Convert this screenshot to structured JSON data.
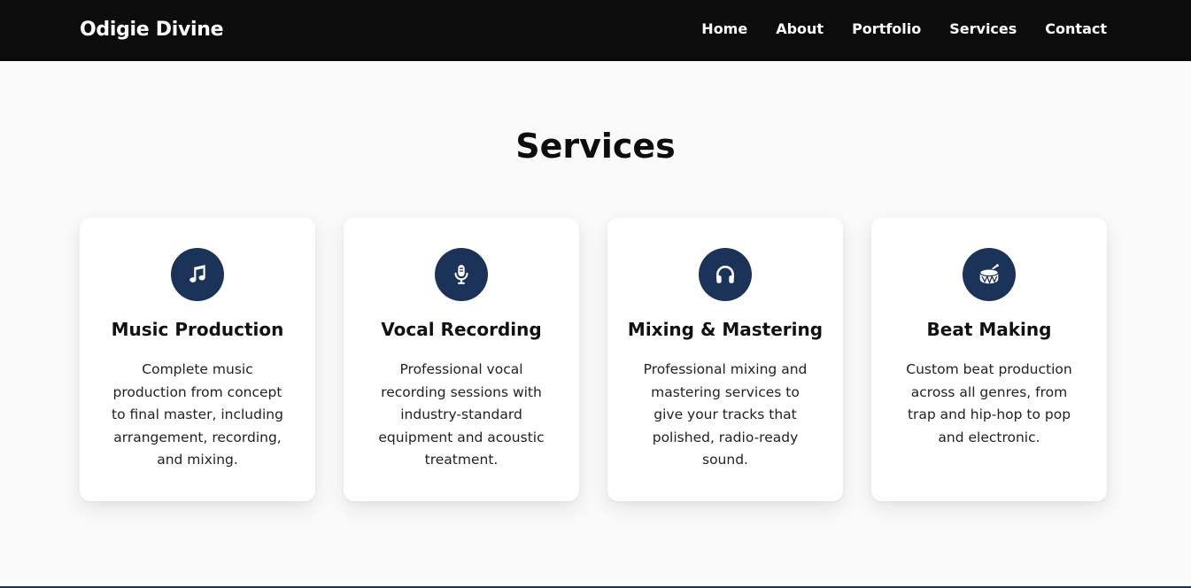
{
  "header": {
    "brand": "Odigie Divine",
    "nav": [
      {
        "label": "Home"
      },
      {
        "label": "About"
      },
      {
        "label": "Portfolio"
      },
      {
        "label": "Services"
      },
      {
        "label": "Contact"
      }
    ]
  },
  "services": {
    "title": "Services",
    "cards": [
      {
        "icon": "music-note-icon",
        "title": "Music Production",
        "description": "Complete music production from concept to final master, including arrangement, recording, and mixing."
      },
      {
        "icon": "microphone-icon",
        "title": "Vocal Recording",
        "description": "Professional vocal recording sessions with industry-standard equipment and acoustic treatment."
      },
      {
        "icon": "headphones-icon",
        "title": "Mixing & Mastering",
        "description": "Professional mixing and mastering services to give your tracks that polished, radio-ready sound."
      },
      {
        "icon": "drum-icon",
        "title": "Beat Making",
        "description": "Custom beat production across all genres, from trap and hip-hop to pop and electronic."
      }
    ]
  },
  "colors": {
    "navbar_bg": "#0c0c0c",
    "accent": "#1b3358",
    "page_bg": "#fafafa",
    "card_bg": "#ffffff"
  }
}
